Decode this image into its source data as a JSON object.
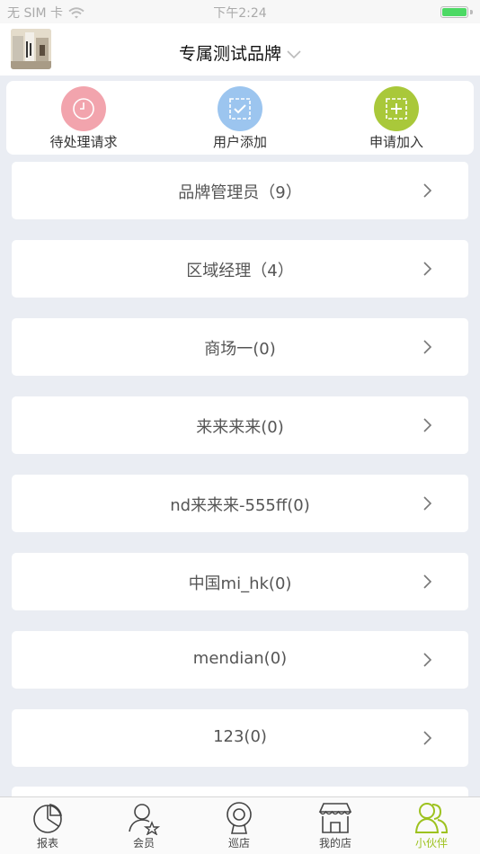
{
  "status_bar": {
    "carrier": "无 SIM 卡",
    "time": "下午2:24"
  },
  "header": {
    "brand_name": "专属测试品牌"
  },
  "quick_actions": [
    {
      "label": "待处理请求",
      "icon": "clock-icon",
      "color": "#f2a4ad"
    },
    {
      "label": "用户添加",
      "icon": "checkbox-icon",
      "color": "#9cc5ef"
    },
    {
      "label": "申请加入",
      "icon": "plus-box-icon",
      "color": "#a9c83a"
    }
  ],
  "groups": [
    {
      "label": "品牌管理员（9）"
    },
    {
      "label": "区域经理（4）"
    },
    {
      "label": "商场一(0)"
    },
    {
      "label": "来来来来(0)"
    },
    {
      "label": "nd来来来-555ff(0)"
    },
    {
      "label": "中国mi_hk(0)"
    },
    {
      "label": "mendian(0)"
    },
    {
      "label": "123(0)"
    }
  ],
  "tabbar": {
    "active_color": "#9dc21f",
    "items": [
      {
        "label": "报表",
        "icon": "pie-chart-icon"
      },
      {
        "label": "会员",
        "icon": "member-star-icon"
      },
      {
        "label": "巡店",
        "icon": "camera-icon"
      },
      {
        "label": "我的店",
        "icon": "store-icon"
      },
      {
        "label": "小伙伴",
        "icon": "partners-icon",
        "active": true
      }
    ]
  }
}
